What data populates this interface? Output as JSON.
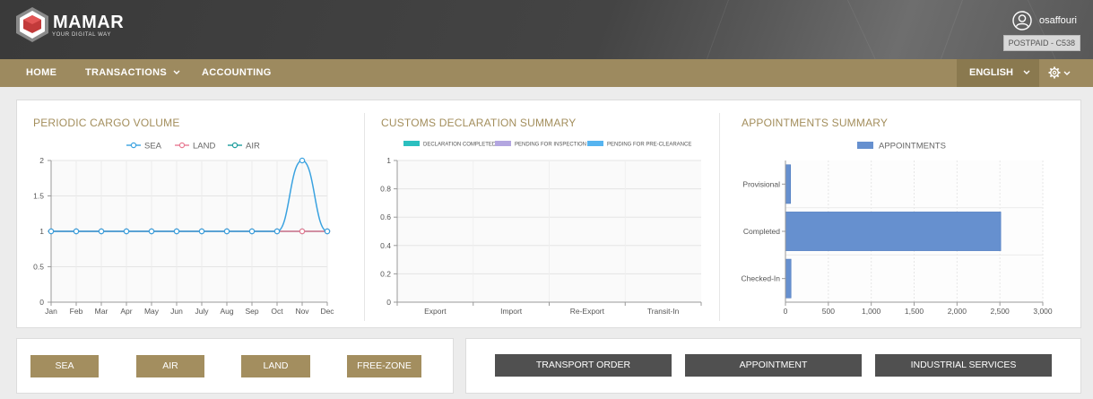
{
  "brand": {
    "name": "MAMAR",
    "tagline": "YOUR DIGITAL WAY",
    "header_color": "#444444",
    "nav_color": "#9d8a5f",
    "accent_title_color": "#a38e5c"
  },
  "user": {
    "name": "osaffouri",
    "plan": "POSTPAID - C538",
    "icon": "user-circle-icon"
  },
  "nav": {
    "items": [
      {
        "label": "HOME"
      },
      {
        "label": "TRANSACTIONS",
        "has_dropdown": true
      },
      {
        "label": "ACCOUNTING"
      }
    ],
    "language": "ENGLISH",
    "settings_icon": "gear-icon"
  },
  "charts": {
    "cargo": {
      "title": "PERIODIC CARGO VOLUME"
    },
    "customs": {
      "title": "CUSTOMS DECLARATION SUMMARY"
    },
    "appointments": {
      "title": "APPOINTMENTS SUMMARY"
    }
  },
  "chart_data": [
    {
      "type": "line",
      "title": "PERIODIC CARGO VOLUME",
      "categories": [
        "Jan",
        "Feb",
        "Mar",
        "Apr",
        "May",
        "Jun",
        "July",
        "Aug",
        "Sep",
        "Oct",
        "Nov",
        "Dec"
      ],
      "series": [
        {
          "name": "SEA",
          "color": "#3aa2e0",
          "values": [
            1,
            1,
            1,
            1,
            1,
            1,
            1,
            1,
            1,
            1,
            2,
            1
          ]
        },
        {
          "name": "LAND",
          "color": "#e87b93",
          "values": [
            1,
            1,
            1,
            1,
            1,
            1,
            1,
            1,
            1,
            1,
            1,
            1
          ]
        },
        {
          "name": "AIR",
          "color": "#1e9e9e",
          "values": [
            1,
            1,
            1,
            1,
            1,
            1,
            1,
            1,
            1,
            1,
            1,
            1
          ]
        }
      ],
      "ylim": [
        0,
        2
      ],
      "yticks": [
        "0",
        "0.5",
        "1",
        "1.5",
        "2"
      ],
      "legend": "top-center",
      "grid": true
    },
    {
      "type": "bar",
      "title": "CUSTOMS DECLARATION SUMMARY",
      "categories": [
        "Export",
        "Import",
        "Re-Export",
        "Transit-In"
      ],
      "series": [
        {
          "name": "DECLARATION COMPLETED",
          "color": "#2bbfbf",
          "values": [
            0,
            0,
            0,
            0
          ]
        },
        {
          "name": "PENDING FOR INSPECTION",
          "color": "#b3a6e0",
          "values": [
            0,
            0,
            0,
            0
          ]
        },
        {
          "name": "PENDING FOR PRE-CLEARANCE",
          "color": "#56b4f0",
          "values": [
            0,
            0,
            0,
            0
          ]
        }
      ],
      "ylim": [
        0,
        1
      ],
      "yticks": [
        "0",
        "0.2",
        "0.4",
        "0.6",
        "0.8",
        "1"
      ],
      "legend": "top-center",
      "grid": true
    },
    {
      "type": "bar",
      "orientation": "horizontal",
      "title": "APPOINTMENTS SUMMARY",
      "categories": [
        "Provisional",
        "Completed",
        "Checked-In"
      ],
      "series": [
        {
          "name": "APPOINTMENTS",
          "color": "#6690cf",
          "values": [
            60,
            2510,
            65
          ]
        }
      ],
      "xlim": [
        0,
        3000
      ],
      "xticks": [
        "0",
        "500",
        "1,000",
        "1,500",
        "2,000",
        "2,500",
        "3,000"
      ],
      "legend": "top-center",
      "grid": true
    }
  ],
  "modes": [
    "SEA",
    "AIR",
    "LAND",
    "FREE-ZONE"
  ],
  "services": [
    "TRANSPORT ORDER",
    "APPOINTMENT",
    "INDUSTRIAL SERVICES"
  ]
}
